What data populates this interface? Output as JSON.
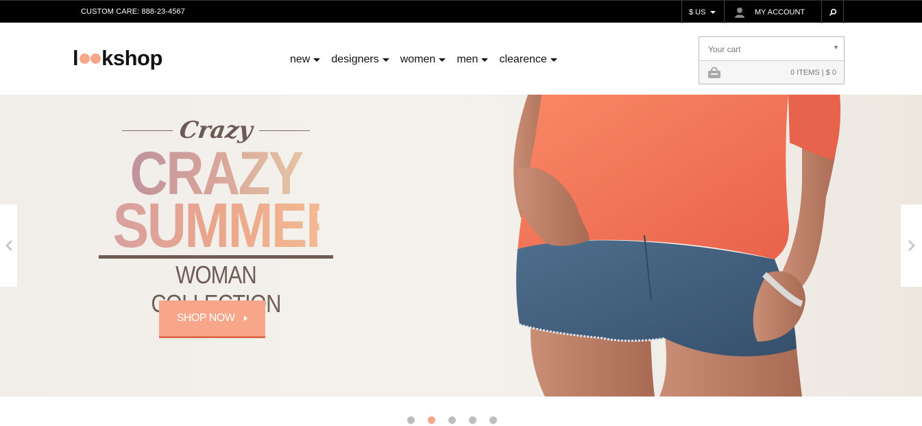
{
  "topbar": {
    "care_text": "CUSTOM CARE: 888-23-4567",
    "currency": "$ US",
    "account_label": "MY ACCOUNT"
  },
  "header": {
    "logo": {
      "start": "l",
      "end": "kshop"
    },
    "nav": [
      {
        "label": "new"
      },
      {
        "label": "designers"
      },
      {
        "label": "women"
      },
      {
        "label": "men"
      },
      {
        "label": "clearence"
      }
    ],
    "cart": {
      "label": "Your cart",
      "summary": "0 ITEMS | $ 0"
    }
  },
  "slide": {
    "script_word": "Crazy",
    "line1": "CRAZY",
    "line2": "SUMMER",
    "subline": "WOMAN COLLECTION",
    "button_label": "SHOP NOW"
  },
  "slider": {
    "slide_count": 5,
    "active_index": 1
  },
  "colors": {
    "accent": "#f7a68a",
    "topbar": "#000000",
    "text_brown": "#6f5c57"
  }
}
